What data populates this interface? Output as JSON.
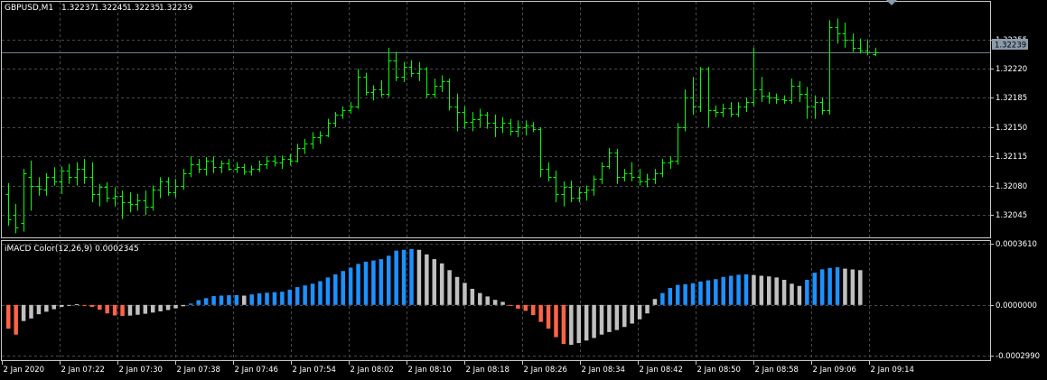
{
  "symbol_info": {
    "symbol": "GBPUSD,M1",
    "open": "1.32237",
    "high": "1.32245",
    "low": "1.32235",
    "close": "1.32239"
  },
  "current_price_label": "1.32239",
  "indicator_label": "iMACD Color(12,26,9) 0.0002345",
  "price_axis_labels": [
    "1.32255",
    "1.32220",
    "1.32185",
    "1.32150",
    "1.32115",
    "1.32080",
    "1.32045"
  ],
  "macd_axis_labels": [
    "0.0003610",
    "0.0000000",
    "-0.0002990"
  ],
  "time_labels": [
    "2 Jan 2020",
    "2 Jan 07:22",
    "2 Jan 07:30",
    "2 Jan 07:38",
    "2 Jan 07:46",
    "2 Jan 07:54",
    "2 Jan 08:02",
    "2 Jan 08:10",
    "2 Jan 08:18",
    "2 Jan 08:26",
    "2 Jan 08:34",
    "2 Jan 08:42",
    "2 Jan 08:50",
    "2 Jan 08:58",
    "2 Jan 09:06",
    "2 Jan 09:14"
  ],
  "colors": {
    "background": "#000000",
    "bar": "#00ff00",
    "grid": "#4a4a4a",
    "price_line": "#70808f",
    "macd_up": "#1e90ff",
    "macd_down": "#c0c0c0",
    "macd_neg_falling": "#ff6347",
    "axis_text": "#ffffff"
  },
  "chart_data": [
    {
      "type": "ohlc",
      "title": "GBPUSD,M1",
      "ylim": [
        1.32018,
        1.323
      ],
      "current_price": 1.32239,
      "bars": [
        [
          1.3207,
          1.32083,
          1.32032,
          1.3204
        ],
        [
          1.32045,
          1.32058,
          1.32023,
          1.3203
        ],
        [
          1.32035,
          1.321,
          1.32025,
          1.32095
        ],
        [
          1.3209,
          1.3211,
          1.3205,
          1.3208
        ],
        [
          1.3208,
          1.3209,
          1.32068,
          1.32076
        ],
        [
          1.32075,
          1.32095,
          1.32068,
          1.3209
        ],
        [
          1.3209,
          1.32102,
          1.3208,
          1.32085
        ],
        [
          1.32085,
          1.32103,
          1.3207,
          1.32098
        ],
        [
          1.32098,
          1.32106,
          1.32082,
          1.3209
        ],
        [
          1.3209,
          1.32108,
          1.3208,
          1.321
        ],
        [
          1.321,
          1.32112,
          1.32082,
          1.3209
        ],
        [
          1.3209,
          1.32108,
          1.3206,
          1.3207
        ],
        [
          1.3207,
          1.32082,
          1.32055,
          1.32078
        ],
        [
          1.32078,
          1.32084,
          1.3206,
          1.32065
        ],
        [
          1.32065,
          1.32078,
          1.32055,
          1.32068
        ],
        [
          1.32068,
          1.32074,
          1.3204,
          1.3206
        ],
        [
          1.3206,
          1.32072,
          1.32048,
          1.32058
        ],
        [
          1.32058,
          1.3207,
          1.3205,
          1.32062
        ],
        [
          1.32062,
          1.32074,
          1.32045,
          1.32055
        ],
        [
          1.32055,
          1.3208,
          1.3205,
          1.32075
        ],
        [
          1.32075,
          1.3209,
          1.32065,
          1.32085
        ],
        [
          1.32085,
          1.3209,
          1.32068,
          1.32072
        ],
        [
          1.32072,
          1.32088,
          1.32066,
          1.3208
        ],
        [
          1.3208,
          1.321,
          1.32075,
          1.32095
        ],
        [
          1.32095,
          1.32115,
          1.3209,
          1.32105
        ],
        [
          1.32105,
          1.32112,
          1.32095,
          1.321
        ],
        [
          1.321,
          1.32114,
          1.32092,
          1.3211
        ],
        [
          1.3211,
          1.32115,
          1.32095,
          1.32102
        ],
        [
          1.32102,
          1.3211,
          1.32095,
          1.32107
        ],
        [
          1.32107,
          1.32112,
          1.32098,
          1.321
        ],
        [
          1.321,
          1.32108,
          1.32095,
          1.32102
        ],
        [
          1.32102,
          1.32106,
          1.32093,
          1.32097
        ],
        [
          1.32097,
          1.32104,
          1.32092,
          1.321
        ],
        [
          1.321,
          1.3211,
          1.32096,
          1.32105
        ],
        [
          1.32105,
          1.32115,
          1.321,
          1.3211
        ],
        [
          1.3211,
          1.32116,
          1.32103,
          1.32108
        ],
        [
          1.32108,
          1.32116,
          1.321,
          1.32112
        ],
        [
          1.32112,
          1.32118,
          1.32104,
          1.3211
        ],
        [
          1.3211,
          1.3213,
          1.32108,
          1.32125
        ],
        [
          1.32125,
          1.32136,
          1.32118,
          1.3213
        ],
        [
          1.3213,
          1.32144,
          1.32124,
          1.32138
        ],
        [
          1.32138,
          1.32145,
          1.3213,
          1.3214
        ],
        [
          1.3214,
          1.3216,
          1.32138,
          1.32155
        ],
        [
          1.32155,
          1.32168,
          1.3215,
          1.32165
        ],
        [
          1.32165,
          1.32175,
          1.3216,
          1.3217
        ],
        [
          1.3217,
          1.3218,
          1.32166,
          1.32175
        ],
        [
          1.32175,
          1.3222,
          1.32172,
          1.3221
        ],
        [
          1.3221,
          1.32215,
          1.32188,
          1.32192
        ],
        [
          1.32192,
          1.322,
          1.32182,
          1.32195
        ],
        [
          1.32195,
          1.32206,
          1.32186,
          1.3219
        ],
        [
          1.3219,
          1.32245,
          1.32186,
          1.3223
        ],
        [
          1.3223,
          1.3224,
          1.32205,
          1.3221
        ],
        [
          1.3221,
          1.32228,
          1.32204,
          1.32222
        ],
        [
          1.32222,
          1.3223,
          1.3221,
          1.32215
        ],
        [
          1.32215,
          1.32228,
          1.32205,
          1.3222
        ],
        [
          1.3222,
          1.32222,
          1.32185,
          1.3219
        ],
        [
          1.3219,
          1.32208,
          1.32185,
          1.322
        ],
        [
          1.322,
          1.32212,
          1.32192,
          1.32205
        ],
        [
          1.32205,
          1.32208,
          1.3217,
          1.32175
        ],
        [
          1.32175,
          1.3219,
          1.32145,
          1.32168
        ],
        [
          1.32168,
          1.32175,
          1.32148,
          1.32156
        ],
        [
          1.32156,
          1.32168,
          1.32145,
          1.3216
        ],
        [
          1.3216,
          1.32172,
          1.3215,
          1.32165
        ],
        [
          1.32165,
          1.32168,
          1.32148,
          1.32155
        ],
        [
          1.32155,
          1.32165,
          1.32138,
          1.3215
        ],
        [
          1.3215,
          1.32162,
          1.32143,
          1.32155
        ],
        [
          1.32155,
          1.3216,
          1.3214,
          1.32145
        ],
        [
          1.32145,
          1.32158,
          1.32138,
          1.3215
        ],
        [
          1.3215,
          1.32158,
          1.3214,
          1.32152
        ],
        [
          1.32152,
          1.32156,
          1.32144,
          1.32148
        ],
        [
          1.32148,
          1.3215,
          1.3209,
          1.321
        ],
        [
          1.321,
          1.32108,
          1.32085,
          1.3209
        ],
        [
          1.3209,
          1.32098,
          1.3206,
          1.3207
        ],
        [
          1.3207,
          1.32085,
          1.32055,
          1.32078
        ],
        [
          1.32078,
          1.32086,
          1.3206,
          1.32065
        ],
        [
          1.32065,
          1.32078,
          1.3206,
          1.32072
        ],
        [
          1.32072,
          1.3208,
          1.32062,
          1.32075
        ],
        [
          1.32075,
          1.32092,
          1.32068,
          1.32088
        ],
        [
          1.32088,
          1.32108,
          1.32082,
          1.32103
        ],
        [
          1.32103,
          1.32125,
          1.321,
          1.3212
        ],
        [
          1.3212,
          1.32124,
          1.32082,
          1.3209
        ],
        [
          1.3209,
          1.321,
          1.32085,
          1.32095
        ],
        [
          1.32095,
          1.32108,
          1.32085,
          1.3209
        ],
        [
          1.3209,
          1.321,
          1.3208,
          1.32085
        ],
        [
          1.32085,
          1.32094,
          1.32078,
          1.32088
        ],
        [
          1.32088,
          1.321,
          1.32082,
          1.32095
        ],
        [
          1.32095,
          1.32112,
          1.3209,
          1.32108
        ],
        [
          1.32108,
          1.32115,
          1.321,
          1.3211
        ],
        [
          1.3211,
          1.32155,
          1.32105,
          1.3215
        ],
        [
          1.3215,
          1.32195,
          1.32145,
          1.32185
        ],
        [
          1.32185,
          1.3221,
          1.32165,
          1.32175
        ],
        [
          1.32175,
          1.32222,
          1.32168,
          1.3222
        ],
        [
          1.3222,
          1.32222,
          1.3215,
          1.3217
        ],
        [
          1.3217,
          1.32176,
          1.32162,
          1.32168
        ],
        [
          1.32168,
          1.32178,
          1.32162,
          1.32172
        ],
        [
          1.32172,
          1.3218,
          1.32162,
          1.32166
        ],
        [
          1.32166,
          1.3218,
          1.32162,
          1.32175
        ],
        [
          1.32175,
          1.32185,
          1.32168,
          1.3218
        ],
        [
          1.3218,
          1.32245,
          1.32175,
          1.32195
        ],
        [
          1.32195,
          1.3221,
          1.3218,
          1.32188
        ],
        [
          1.32188,
          1.32192,
          1.32178,
          1.32185
        ],
        [
          1.32185,
          1.3219,
          1.32178,
          1.32183
        ],
        [
          1.32183,
          1.32188,
          1.32178,
          1.32182
        ],
        [
          1.32182,
          1.32208,
          1.32178,
          1.322
        ],
        [
          1.322,
          1.32205,
          1.3218,
          1.3219
        ],
        [
          1.3219,
          1.32198,
          1.3216,
          1.32175
        ],
        [
          1.32175,
          1.32188,
          1.3216,
          1.3218
        ],
        [
          1.3218,
          1.32185,
          1.32165,
          1.3217
        ],
        [
          1.3217,
          1.32278,
          1.32165,
          1.3227
        ],
        [
          1.3227,
          1.3228,
          1.3225,
          1.32262
        ],
        [
          1.32262,
          1.32275,
          1.32245,
          1.32255
        ],
        [
          1.32255,
          1.32262,
          1.3224,
          1.32245
        ],
        [
          1.32245,
          1.32256,
          1.32238,
          1.32242
        ],
        [
          1.32242,
          1.32255,
          1.32236,
          1.3224
        ],
        [
          1.32237,
          1.32245,
          1.32235,
          1.32239
        ]
      ]
    },
    {
      "type": "bar",
      "title": "iMACD Color(12,26,9)",
      "ylim": [
        -0.000299,
        0.000361
      ],
      "yticks": [
        0.000361,
        0.0,
        -0.000299
      ],
      "bars": [
        [
          -0.00014,
          "r"
        ],
        [
          -0.000175,
          "r"
        ],
        [
          -9.5e-05,
          "g"
        ],
        [
          -8e-05,
          "g"
        ],
        [
          -5.5e-05,
          "g"
        ],
        [
          -4e-05,
          "g"
        ],
        [
          -2.5e-05,
          "g"
        ],
        [
          -1.2e-05,
          "g"
        ],
        [
          -5e-06,
          "g"
        ],
        [
          4e-06,
          "g"
        ],
        [
          -3e-06,
          "r"
        ],
        [
          -1.2e-05,
          "r"
        ],
        [
          -2.8e-05,
          "r"
        ],
        [
          -5e-05,
          "r"
        ],
        [
          -6.2e-05,
          "r"
        ],
        [
          -6.5e-05,
          "r"
        ],
        [
          -6.3e-05,
          "g"
        ],
        [
          -5.8e-05,
          "g"
        ],
        [
          -5.2e-05,
          "g"
        ],
        [
          -4.5e-05,
          "g"
        ],
        [
          -3.8e-05,
          "g"
        ],
        [
          -3e-05,
          "g"
        ],
        [
          -2e-05,
          "g"
        ],
        [
          -8e-06,
          "g"
        ],
        [
          8e-06,
          "b"
        ],
        [
          2.8e-05,
          "b"
        ],
        [
          4e-05,
          "b"
        ],
        [
          5.2e-05,
          "b"
        ],
        [
          5.5e-05,
          "b"
        ],
        [
          5.7e-05,
          "b"
        ],
        [
          5.8e-05,
          "b"
        ],
        [
          5.5e-05,
          "g"
        ],
        [
          6.2e-05,
          "b"
        ],
        [
          6.8e-05,
          "b"
        ],
        [
          7.2e-05,
          "b"
        ],
        [
          7.5e-05,
          "b"
        ],
        [
          7.8e-05,
          "b"
        ],
        [
          9e-05,
          "b"
        ],
        [
          0.000105,
          "b"
        ],
        [
          0.000115,
          "b"
        ],
        [
          0.000125,
          "b"
        ],
        [
          0.00014,
          "b"
        ],
        [
          0.000162,
          "b"
        ],
        [
          0.00018,
          "b"
        ],
        [
          0.0002,
          "b"
        ],
        [
          0.00022,
          "b"
        ],
        [
          0.000242,
          "b"
        ],
        [
          0.000255,
          "b"
        ],
        [
          0.000262,
          "b"
        ],
        [
          0.00027,
          "b"
        ],
        [
          0.00029,
          "b"
        ],
        [
          0.00032,
          "b"
        ],
        [
          0.000325,
          "b"
        ],
        [
          0.00033,
          "b"
        ],
        [
          0.000325,
          "g"
        ],
        [
          0.000298,
          "g"
        ],
        [
          0.00027,
          "g"
        ],
        [
          0.000245,
          "g"
        ],
        [
          0.000205,
          "g"
        ],
        [
          0.000165,
          "g"
        ],
        [
          0.00013,
          "g"
        ],
        [
          9.5e-05,
          "g"
        ],
        [
          7e-05,
          "g"
        ],
        [
          5e-05,
          "g"
        ],
        [
          3e-05,
          "g"
        ],
        [
          1.8e-05,
          "g"
        ],
        [
          -5e-06,
          "r"
        ],
        [
          -2.2e-05,
          "r"
        ],
        [
          -3.5e-05,
          "r"
        ],
        [
          -6e-05,
          "r"
        ],
        [
          -0.0001,
          "r"
        ],
        [
          -0.00014,
          "r"
        ],
        [
          -0.00019,
          "r"
        ],
        [
          -0.00023,
          "r"
        ],
        [
          -0.000235,
          "g"
        ],
        [
          -0.000225,
          "g"
        ],
        [
          -0.00021,
          "g"
        ],
        [
          -0.000195,
          "g"
        ],
        [
          -0.000175,
          "g"
        ],
        [
          -0.00016,
          "g"
        ],
        [
          -0.000148,
          "g"
        ],
        [
          -0.00013,
          "g"
        ],
        [
          -0.00011,
          "g"
        ],
        [
          -8.5e-05,
          "g"
        ],
        [
          -5e-05,
          "g"
        ],
        [
          3.5e-05,
          "g"
        ],
        [
          7e-05,
          "b"
        ],
        [
          0.0001,
          "b"
        ],
        [
          0.000118,
          "b"
        ],
        [
          0.000122,
          "b"
        ],
        [
          0.000128,
          "b"
        ],
        [
          0.000138,
          "b"
        ],
        [
          0.000145,
          "b"
        ],
        [
          0.000152,
          "b"
        ],
        [
          0.000165,
          "b"
        ],
        [
          0.000172,
          "b"
        ],
        [
          0.000178,
          "b"
        ],
        [
          0.00018,
          "b"
        ],
        [
          0.000176,
          "g"
        ],
        [
          0.000172,
          "g"
        ],
        [
          0.000168,
          "g"
        ],
        [
          0.000162,
          "g"
        ],
        [
          0.000148,
          "g"
        ],
        [
          0.000125,
          "g"
        ],
        [
          0.000112,
          "g"
        ],
        [
          0.000148,
          "b"
        ],
        [
          0.00019,
          "b"
        ],
        [
          0.00021,
          "b"
        ],
        [
          0.000218,
          "b"
        ],
        [
          0.000222,
          "b"
        ],
        [
          0.000214,
          "g"
        ],
        [
          0.000209,
          "g"
        ],
        [
          0.000205,
          "g"
        ]
      ]
    }
  ]
}
